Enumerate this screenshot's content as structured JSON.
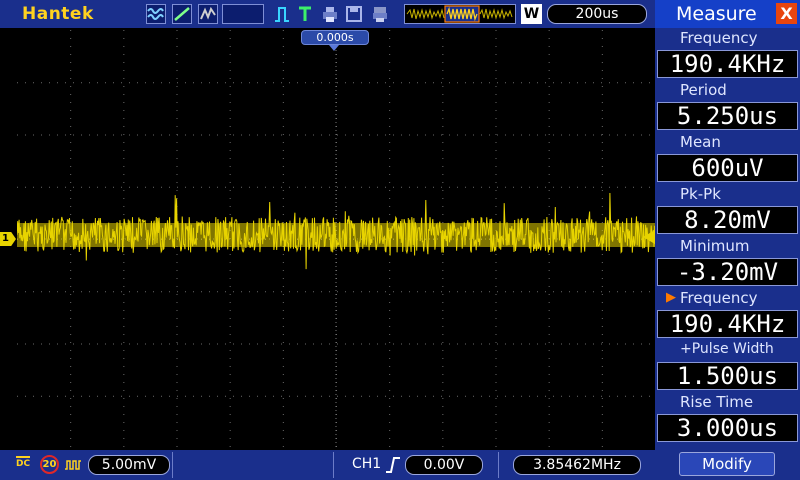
{
  "header": {
    "brand": "Hantek",
    "memory_depth_label": "W",
    "timebase": "200us",
    "trigger_position": "0.000s",
    "icons": [
      "waveform-wave-icon",
      "waveform-ramp-icon",
      "waveform-arbitrary-icon",
      "pulse-icon",
      "trigger-t-icon",
      "save-icon",
      "print-icon",
      "waveform-overview-icon"
    ]
  },
  "channel": {
    "marker": "1",
    "color": "#e8d400",
    "coupling": "DC",
    "bandwidth_limit": "20",
    "volts_per_div": "5.00mV"
  },
  "trigger": {
    "source": "CH1",
    "level": "0.00V",
    "frequency": "3.85462MHz"
  },
  "measure": {
    "title": "Measure",
    "close_label": "X",
    "items": [
      {
        "label": "Frequency",
        "value": "190.4KHz",
        "selected": false
      },
      {
        "label": "Period",
        "value": "5.250us",
        "selected": false
      },
      {
        "label": "Mean",
        "value": "600uV",
        "selected": false
      },
      {
        "label": "Pk-Pk",
        "value": "8.20mV",
        "selected": false
      },
      {
        "label": "Minimum",
        "value": "-3.20mV",
        "selected": false
      },
      {
        "label": "Frequency",
        "value": "190.4KHz",
        "selected": true
      },
      {
        "label": "+Pulse Width",
        "value": "1.500us",
        "selected": false
      },
      {
        "label": "Rise Time",
        "value": "3.000us",
        "selected": false
      }
    ],
    "modify_label": "Modify"
  },
  "colors": {
    "bar_blue": "#1a2f8c",
    "panel_title": "#1540c8",
    "accent_yellow": "#ffd21f",
    "close_orange": "#e8450f"
  }
}
